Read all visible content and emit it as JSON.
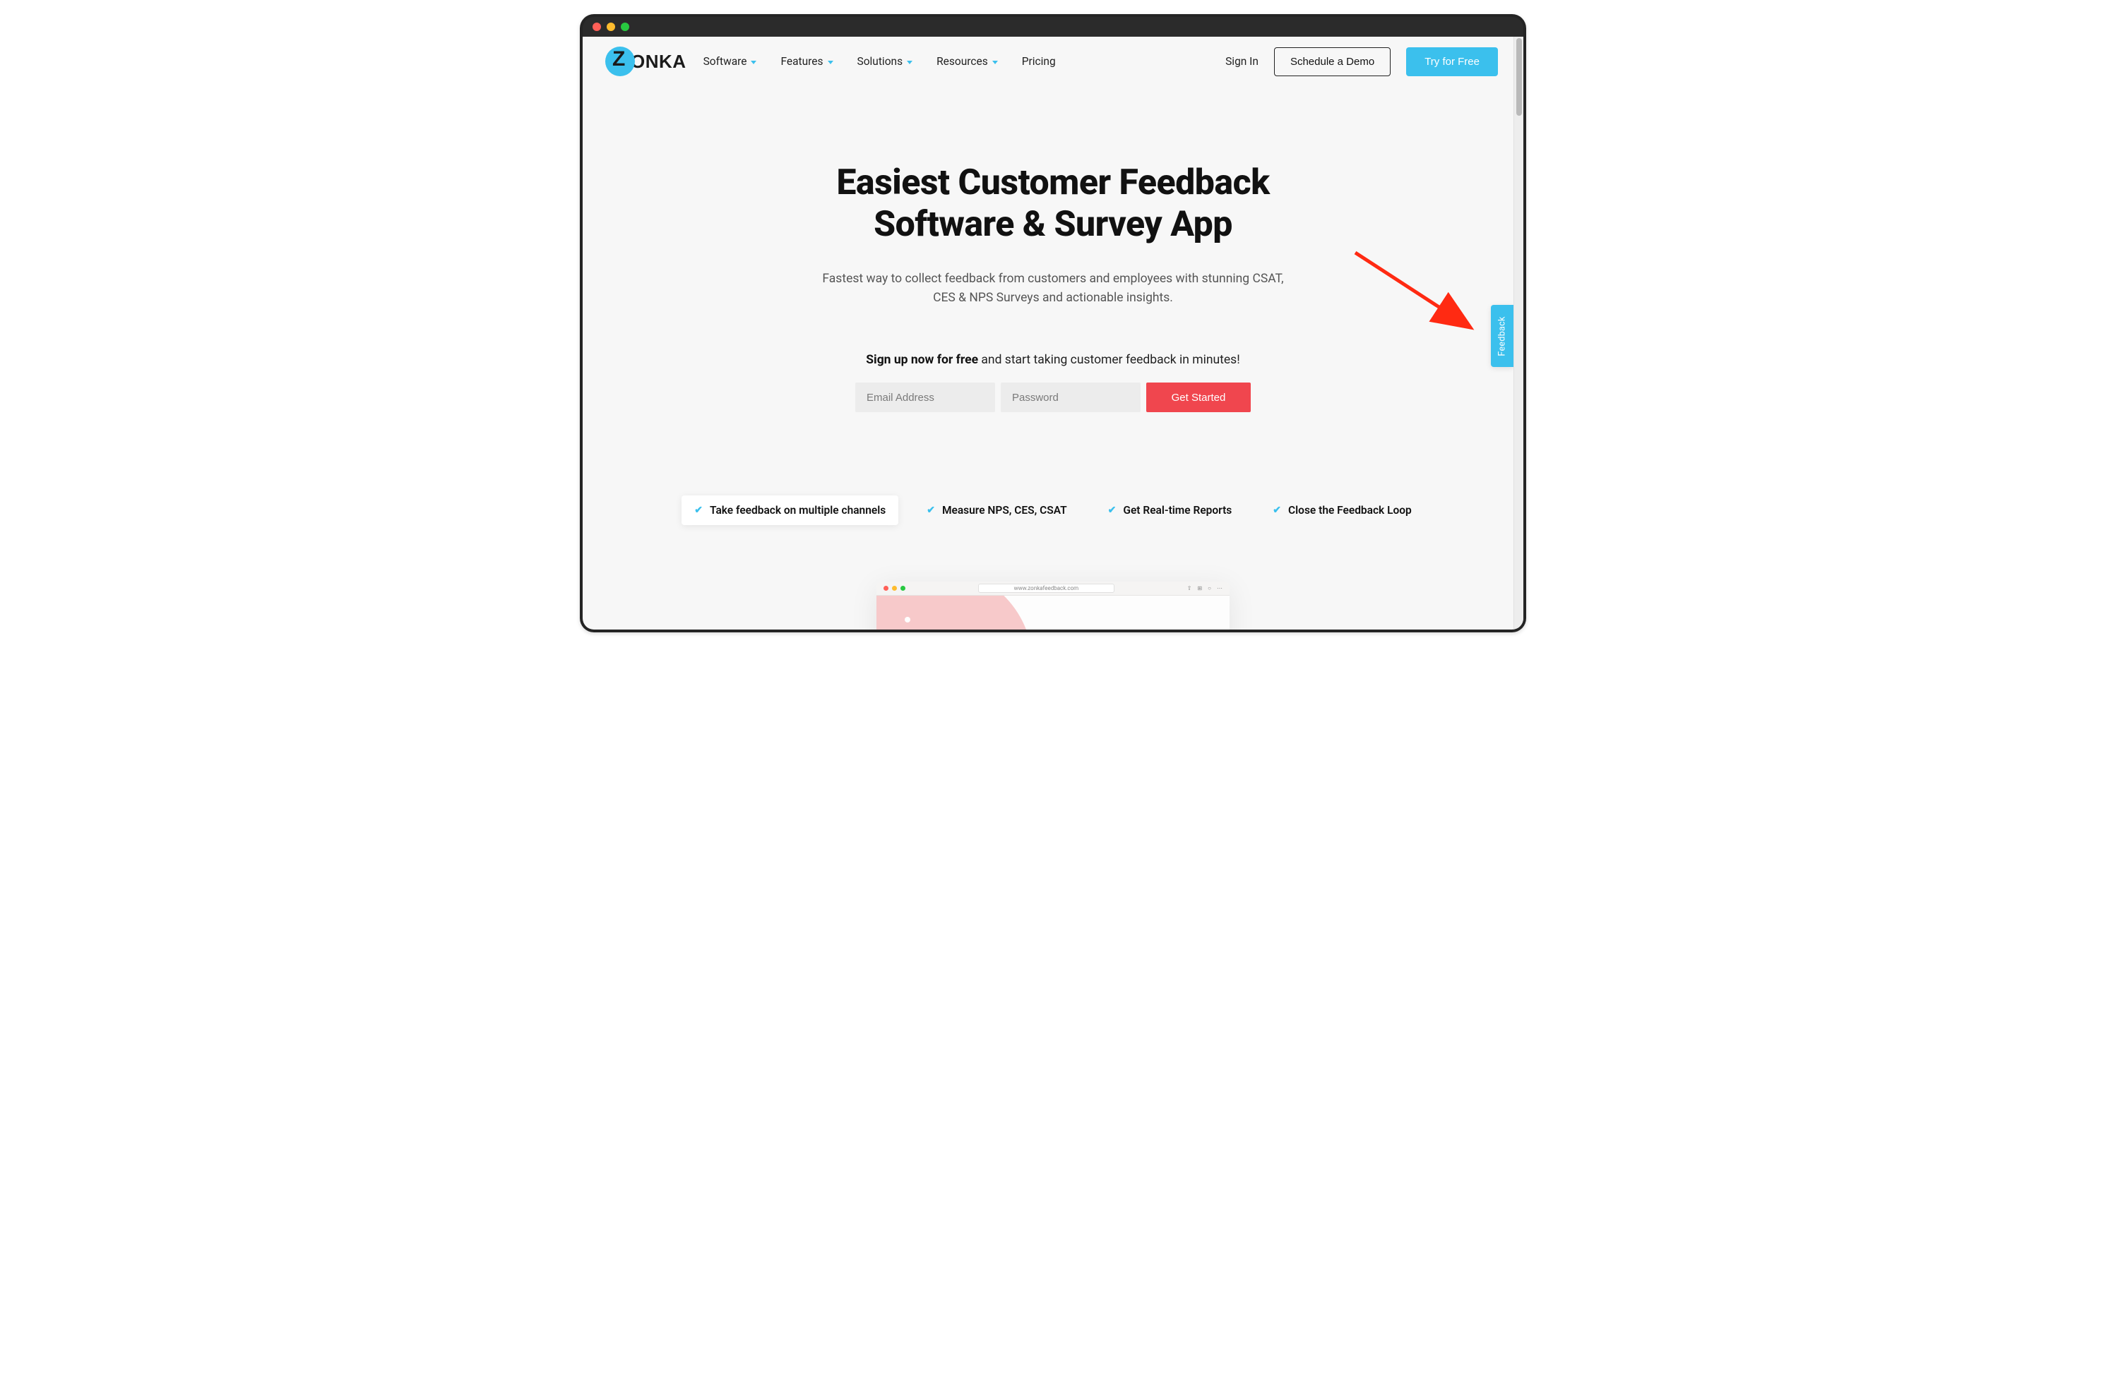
{
  "nav": {
    "logo_text": "ONKA",
    "logo_letter": "Z",
    "items": [
      {
        "label": "Software",
        "dropdown": true
      },
      {
        "label": "Features",
        "dropdown": true
      },
      {
        "label": "Solutions",
        "dropdown": true
      },
      {
        "label": "Resources",
        "dropdown": true
      },
      {
        "label": "Pricing",
        "dropdown": false
      }
    ],
    "signin": "Sign In",
    "schedule_demo": "Schedule a Demo",
    "try_free": "Try for Free"
  },
  "hero": {
    "title_line1": "Easiest Customer Feedback",
    "title_line2": "Software & Survey App",
    "subtitle": "Fastest way to collect feedback from customers and employees with stunning CSAT, CES & NPS Surveys and actionable insights.",
    "signup_bold": "Sign up now for free",
    "signup_rest": " and start taking customer feedback in minutes!",
    "email_placeholder": "Email Address",
    "password_placeholder": "Password",
    "cta": "Get Started"
  },
  "features": [
    "Take feedback on multiple channels",
    "Measure NPS, CES, CSAT",
    "Get Real-time Reports",
    "Close the Feedback Loop"
  ],
  "preview": {
    "url": "www.zonkafeedback.com"
  },
  "side_tab": "Feedback"
}
